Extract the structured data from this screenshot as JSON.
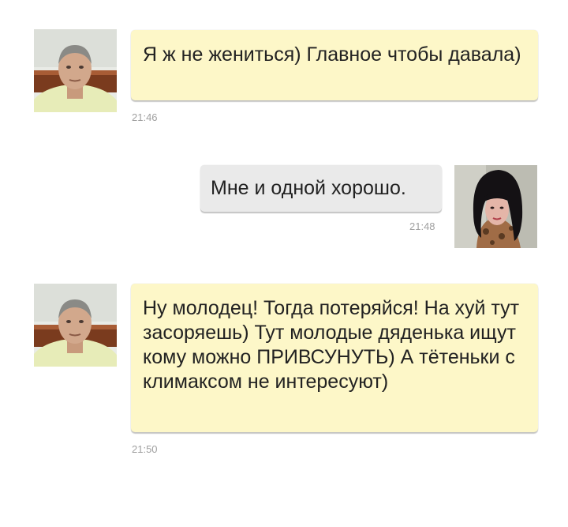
{
  "messages": [
    {
      "direction": "incoming",
      "avatar": "male-avatar",
      "text": "Я ж не жениться) Главное чтобы давала)",
      "time": "21:46"
    },
    {
      "direction": "outgoing",
      "avatar": "female-avatar",
      "text": "Мне и одной хорошо.",
      "time": "21:48"
    },
    {
      "direction": "incoming",
      "avatar": "male-avatar",
      "text": "Ну молодец! Тогда потеряйся! На хуй тут засоряешь) Тут молодые дяденька ищут кому можно ПРИВСУНУТЬ) А тётеньки с климаксом не интересуют)",
      "time": "21:50"
    }
  ],
  "colors": {
    "incoming_bubble": "#fdf7c8",
    "outgoing_bubble": "#eaeaea",
    "timestamp": "#a0a0a0"
  }
}
